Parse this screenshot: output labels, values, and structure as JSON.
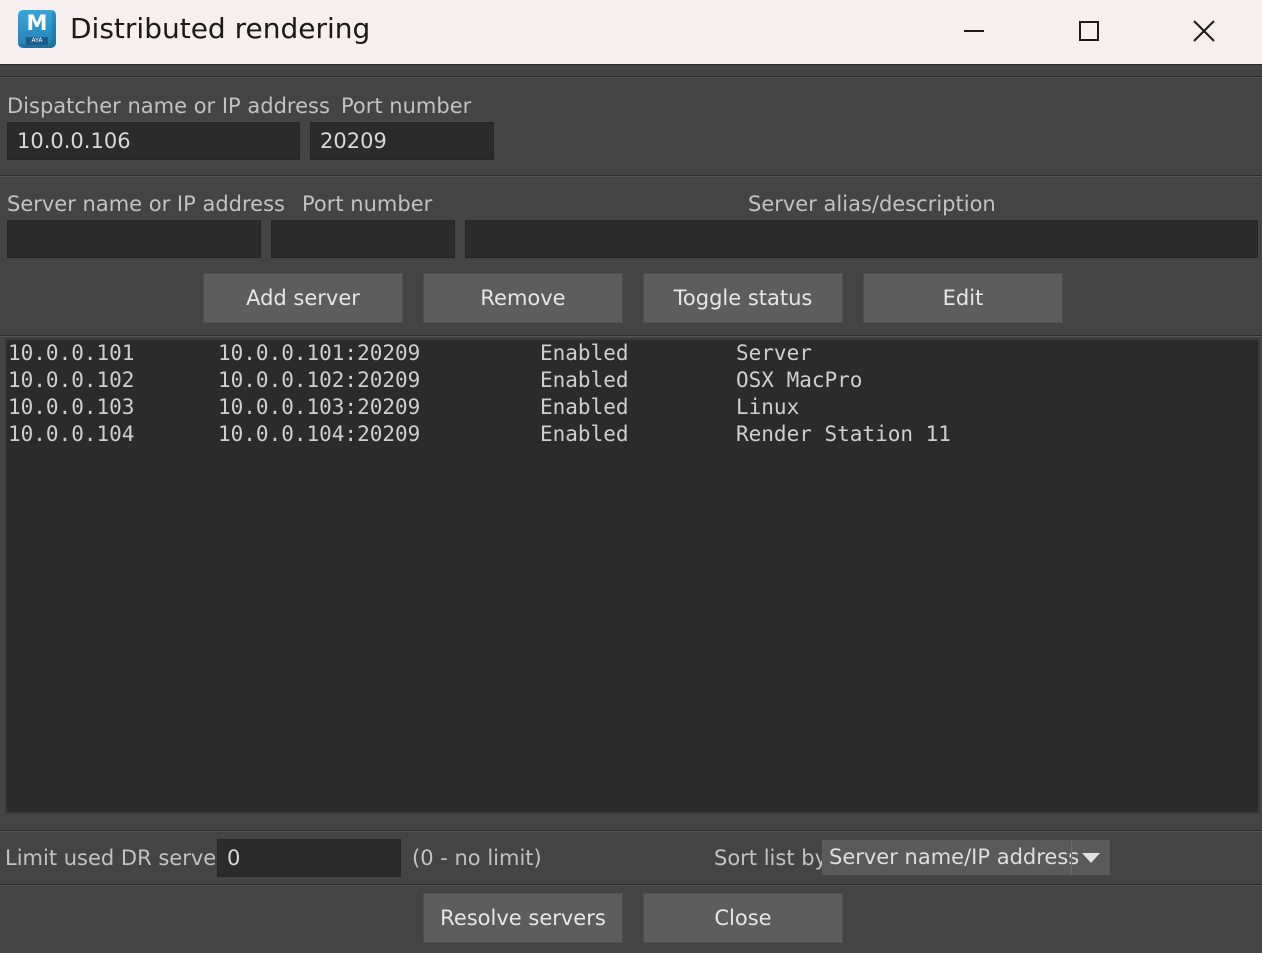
{
  "window": {
    "title": "Distributed rendering",
    "logo_letter": "M",
    "logo_sub": "AYA"
  },
  "dispatcher": {
    "name_label": "Dispatcher name or IP address",
    "name_value": "10.0.0.106",
    "port_label": "Port number",
    "port_value": "20209"
  },
  "server_form": {
    "name_label": "Server name or IP address",
    "name_value": "",
    "port_label": "Port number",
    "port_value": "",
    "alias_label": "Server alias/description",
    "alias_value": ""
  },
  "buttons": {
    "add": "Add server",
    "remove": "Remove",
    "toggle": "Toggle status",
    "edit": "Edit",
    "resolve": "Resolve servers",
    "close": "Close"
  },
  "servers": [
    {
      "name": "10.0.0.101",
      "address": "10.0.0.101:20209",
      "status": "Enabled",
      "alias": "Server"
    },
    {
      "name": "10.0.0.102",
      "address": "10.0.0.102:20209",
      "status": "Enabled",
      "alias": "OSX MacPro"
    },
    {
      "name": "10.0.0.103",
      "address": "10.0.0.103:20209",
      "status": "Enabled",
      "alias": "Linux"
    },
    {
      "name": "10.0.0.104",
      "address": "10.0.0.104:20209",
      "status": "Enabled",
      "alias": "Render Station 11"
    }
  ],
  "footer": {
    "limit_label": "Limit used DR servers",
    "limit_value": "0",
    "limit_hint": "(0 - no limit)",
    "sort_label": "Sort list by",
    "sort_value": "Server name/IP address"
  },
  "icons": {
    "minimize": "minimize-icon",
    "maximize": "maximize-icon",
    "close": "close-icon",
    "dropdown": "chevron-down-icon"
  },
  "colors": {
    "background": "#444444",
    "field": "#2b2b2b",
    "button": "#5d5d5d",
    "titlebar": "#f7eeef"
  }
}
